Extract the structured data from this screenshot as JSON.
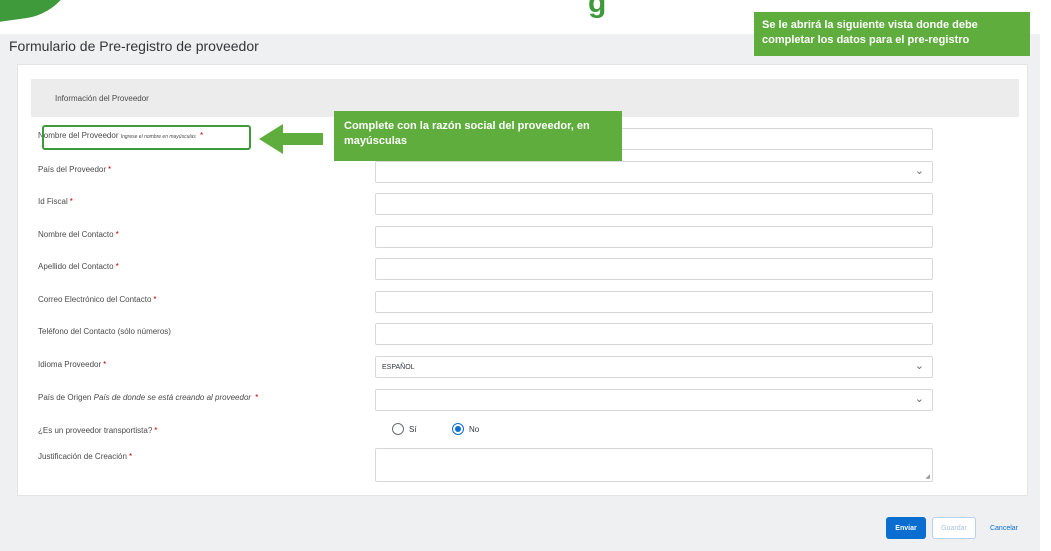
{
  "page": {
    "title": "Formulario de Pre-registro de proveedor",
    "section_title": "Información del Proveedor",
    "deco_text": "g"
  },
  "fields": {
    "supplier_name": {
      "label": "Nombre del Proveedor",
      "hint": "Ingrese el nombre en mayúsculas",
      "required": "*",
      "value": ""
    },
    "supplier_country": {
      "label": "País del Proveedor",
      "required": "*",
      "value": ""
    },
    "tax_id": {
      "label": "Id Fiscal",
      "required": "*",
      "value": ""
    },
    "contact_first_name": {
      "label": "Nombre del Contacto",
      "required": "*",
      "value": ""
    },
    "contact_last_name": {
      "label": "Apellido del Contacto",
      "required": "*",
      "value": ""
    },
    "contact_email": {
      "label": "Correo Electrónico del Contacto",
      "required": "*",
      "value": ""
    },
    "contact_phone": {
      "label": "Teléfono del Contacto (sólo números)",
      "value": ""
    },
    "supplier_language": {
      "label": "Idioma Proveedor",
      "required": "*",
      "value": "ESPAÑOL"
    },
    "origin_country": {
      "label": "País de Origen",
      "hint": "País de donde se está creando al proveedor",
      "required": "*",
      "value": ""
    },
    "is_carrier": {
      "label": "¿Es un proveedor transportista?",
      "required": "*",
      "options": [
        "Sí",
        "No"
      ],
      "selected": "No"
    },
    "justification": {
      "label": "Justificación de Creación",
      "required": "*",
      "value": ""
    }
  },
  "buttons": {
    "send": "Enviar",
    "save": "Guardar",
    "cancel": "Cancelar"
  },
  "callouts": {
    "top": "Se le abrirá la siguiente vista donde debe completar los datos para el pre-registro",
    "mid": "Complete con la razón social del proveedor, en mayúsculas"
  },
  "icons": {
    "dropdown": "chevron-down-icon",
    "arrow": "arrow-left-icon"
  },
  "colors": {
    "accent": "#0a6ed1",
    "callout": "#5fad3d",
    "required": "#bb0000",
    "highlight": "#3f9a3b"
  }
}
